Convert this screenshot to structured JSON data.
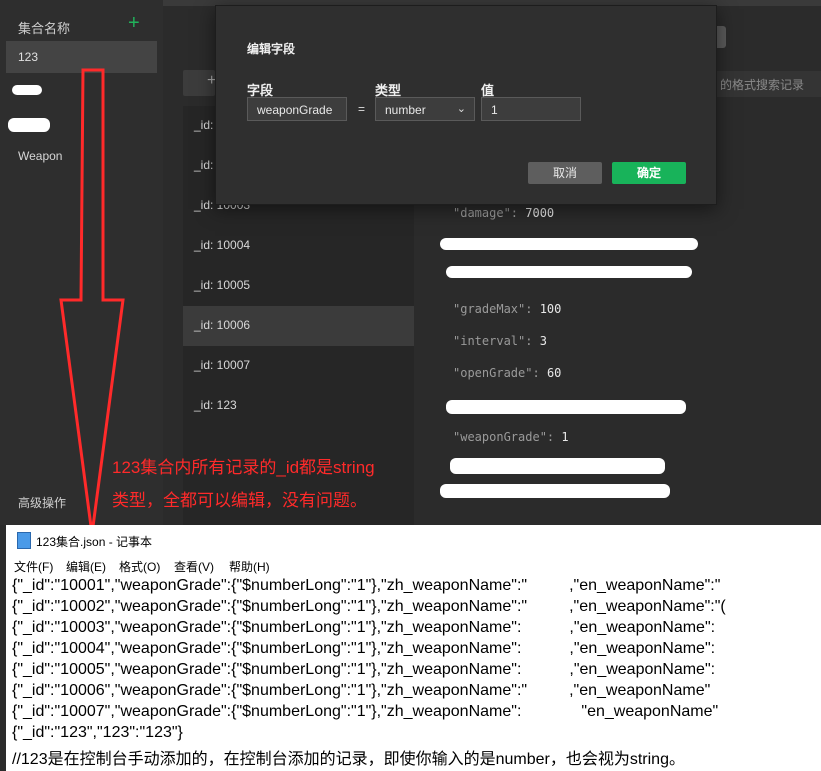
{
  "sidebar": {
    "header": "集合名称",
    "add_icon": "plus-icon",
    "selected": "123",
    "items": [
      "Weapon"
    ],
    "advanced": "高级操作"
  },
  "records": [
    "_id:",
    "_id:",
    "_id: 10003",
    "_id: 10004",
    "_id: 10005",
    "_id: 10006",
    "_id: 10007",
    "_id: 123"
  ],
  "detail": [
    {
      "key": "\"damage\"",
      "value": "7000"
    },
    {
      "key": "\"gradeMax\"",
      "value": "100"
    },
    {
      "key": "\"interval\"",
      "value": "3"
    },
    {
      "key": "\"openGrade\"",
      "value": "60"
    },
    {
      "key": "\"weaponGrade\"",
      "value": "1"
    }
  ],
  "search_hint": "的格式搜索记录",
  "modal": {
    "title": "编辑字段",
    "field_label": "字段",
    "type_label": "类型",
    "value_label": "值",
    "field_value": "weaponGrade",
    "equals": "=",
    "type_value": "number",
    "value_value": "1",
    "cancel": "取消",
    "confirm": "确定"
  },
  "annotation": {
    "line1": "123集合内所有记录的_id都是string",
    "line2": "类型，全都可以编辑，没有问题。"
  },
  "notepad": {
    "title": "123集合.json - 记事本",
    "menu": [
      "文件(F)",
      "编辑(E)",
      "格式(O)",
      "查看(V)",
      "帮助(H)"
    ],
    "lines": [
      "{\"_id\":\"10001\",\"weaponGrade\":{\"$numberLong\":\"1\"},\"zh_weaponName\":\"",
      "{\"_id\":\"10002\",\"weaponGrade\":{\"$numberLong\":\"1\"},\"zh_weaponName\":\"",
      "{\"_id\":\"10003\",\"weaponGrade\":{\"$numberLong\":\"1\"},\"zh_weaponName\":",
      "{\"_id\":\"10004\",\"weaponGrade\":{\"$numberLong\":\"1\"},\"zh_weaponName\":",
      "{\"_id\":\"10005\",\"weaponGrade\":{\"$numberLong\":\"1\"},\"zh_weaponName\":",
      "{\"_id\":\"10006\",\"weaponGrade\":{\"$numberLong\":\"1\"},\"zh_weaponName\":\"",
      "{\"_id\":\"10007\",\"weaponGrade\":{\"$numberLong\":\"1\"},\"zh_weaponName\":",
      "{\"_id\":\"123\",\"123\":\"123\"}"
    ],
    "tails": [
      ",\"en_weaponName\":\"",
      ",\"en_weaponName\":\"(",
      ",\"en_weaponName\":",
      ",\"en_weaponName\":",
      ",\"en_weaponName\":",
      ",\"en_weaponName\"",
      "\"en_weaponName\"",
      ""
    ],
    "bottom_line": "//123是在控制台手动添加的，在控制台添加的记录，即使你输入的是number，也会视为string。"
  },
  "colors": {
    "accent": "#21b25b",
    "annotation": "#ff2a2a",
    "cancel_bg": "#5e5e5e",
    "confirm_bg": "#18b35a"
  }
}
